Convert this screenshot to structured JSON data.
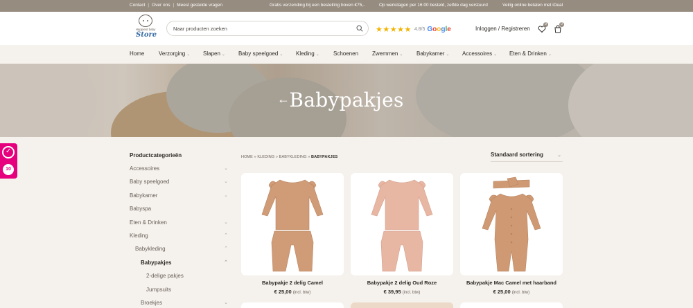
{
  "topbar": {
    "links": [
      "Contact",
      "Over ons",
      "Meest gestelde vragen"
    ],
    "usps": [
      "Gratis verzending bij een bestelling boven €75,-",
      "Op werkdagen per 16:00 besteld, zelfde dag verstuurd",
      "Veilig online betalen met iDeal"
    ]
  },
  "header": {
    "logo_line1": "Happiest baby",
    "logo_line2": "Store",
    "search_placeholder": "Naar producten zoeken",
    "stars": "★★★★★",
    "score": "4.8/5",
    "google": [
      "G",
      "o",
      "o",
      "g",
      "l",
      "e"
    ],
    "login": "Inloggen / Registreren",
    "wishlist_count": "0",
    "cart_count": "0"
  },
  "nav": [
    {
      "label": "Home",
      "has_chev": false
    },
    {
      "label": "Verzorging",
      "has_chev": true
    },
    {
      "label": "Slapen",
      "has_chev": true
    },
    {
      "label": "Baby speelgoed",
      "has_chev": true
    },
    {
      "label": "Kleding",
      "has_chev": true
    },
    {
      "label": "Schoenen",
      "has_chev": false
    },
    {
      "label": "Zwemmen",
      "has_chev": true
    },
    {
      "label": "Babykamer",
      "has_chev": true
    },
    {
      "label": "Accessoires",
      "has_chev": true
    },
    {
      "label": "Eten & Drinken",
      "has_chev": true
    }
  ],
  "hero": {
    "back_arrow": "←",
    "title": "Babypakjes"
  },
  "floating_badge": {
    "count": "10"
  },
  "sidebar": {
    "title": "Productcategorieën",
    "categories": [
      {
        "label": "Accessoires",
        "chev": "⌄",
        "level": 0,
        "active": false
      },
      {
        "label": "Baby speelgoed",
        "chev": "⌄",
        "level": 0,
        "active": false
      },
      {
        "label": "Babykamer",
        "chev": "⌄",
        "level": 0,
        "active": false
      },
      {
        "label": "Babyspa",
        "chev": "",
        "level": 0,
        "active": false
      },
      {
        "label": "Eten & Drinken",
        "chev": "⌄",
        "level": 0,
        "active": false
      },
      {
        "label": "Kleding",
        "chev": "⌃",
        "level": 0,
        "active": false
      },
      {
        "label": "Babykleding",
        "chev": "⌃",
        "level": 1,
        "active": false
      },
      {
        "label": "Babypakjes",
        "chev": "⌃",
        "level": 2,
        "active": true
      },
      {
        "label": "2-delige pakjes",
        "chev": "",
        "level": 3,
        "active": false
      },
      {
        "label": "Jumpsuits",
        "chev": "",
        "level": 3,
        "active": false
      },
      {
        "label": "Broekjes",
        "chev": "⌄",
        "level": 2,
        "active": false
      }
    ]
  },
  "breadcrumb": {
    "parts": [
      "HOME",
      "KLEDING",
      "BABYKLEDING"
    ],
    "separator": "»",
    "current": "BABYPAKJES"
  },
  "sort": {
    "label": "Standaard sortering",
    "chev": "⌄"
  },
  "products": [
    {
      "name": "Babypakje 2 delig Camel",
      "price": "€ 25,00",
      "btw": "(incl. btw)",
      "color": "#cf9c77"
    },
    {
      "name": "Babypakje 2 delig Oud Roze",
      "price": "€ 39,95",
      "btw": "(incl. btw)",
      "color": "#e8b7a4"
    },
    {
      "name": "Babypakje Mac Camel met haarband",
      "price": "€ 25,00",
      "btw": "(incl. btw)",
      "color": "#cf9a73"
    }
  ],
  "colors": {
    "topbar": "#978c80",
    "background": "#f5f1ec",
    "badge_pink": "#e6007e",
    "stars": "#f2b300"
  }
}
